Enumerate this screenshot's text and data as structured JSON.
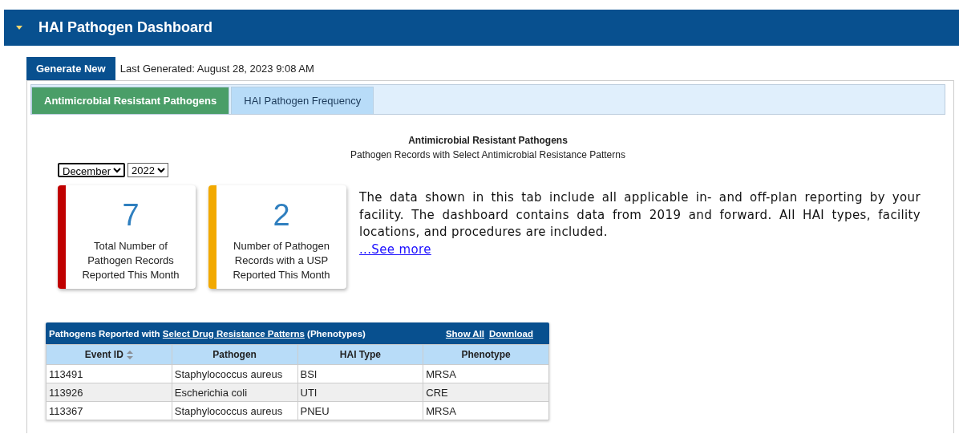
{
  "header": {
    "title": "HAI Pathogen Dashboard",
    "expanded": true
  },
  "toolbar": {
    "button": "Generate New",
    "last_generated": "Last Generated: August 28, 2023 9:08 AM"
  },
  "tabs": [
    {
      "label": "Antimicrobial Resistant Pathogens",
      "selected": true
    },
    {
      "label": "HAI Pathogen Frequency",
      "selected": false
    }
  ],
  "report": {
    "title": "Antimicrobial Resistant Pathogens",
    "subtitle": "Pathogen Records with Select Antimicrobial Resistance Patterns"
  },
  "filters": {
    "month": "December",
    "year": "2022"
  },
  "cards": [
    {
      "value": "7",
      "label": "Total Number of Pathogen Records Reported This Month",
      "color": "#c00000"
    },
    {
      "value": "2",
      "label": "Number of Pathogen Records with a USP Reported This Month",
      "color": "#f2a900"
    }
  ],
  "description": {
    "text": "The data shown in this tab include all applicable in- and off-plan reporting by your facility. The dashboard contains data from 2019 and forward. All HAI types, facility locations, and procedures are included.",
    "link": "...See more"
  },
  "table": {
    "title_prefix": "Pathogens Reported with",
    "title_link": "Select Drug Resistance Patterns",
    "title_suffix": "(Phenotypes)",
    "actions": [
      "Show All",
      "Download"
    ],
    "columns": [
      {
        "label": "Event ID",
        "sortable": true
      },
      {
        "label": "Pathogen",
        "sortable": false
      },
      {
        "label": "HAI Type",
        "sortable": false
      },
      {
        "label": "Phenotype",
        "sortable": false
      }
    ],
    "rows": [
      [
        "113491",
        "Staphylococcus aureus",
        "BSI",
        "MRSA"
      ],
      [
        "113926",
        "Escherichia coli",
        "UTI",
        "CRE"
      ],
      [
        "113367",
        "Staphylococcus aureus",
        "PNEU",
        "MRSA"
      ]
    ]
  }
}
